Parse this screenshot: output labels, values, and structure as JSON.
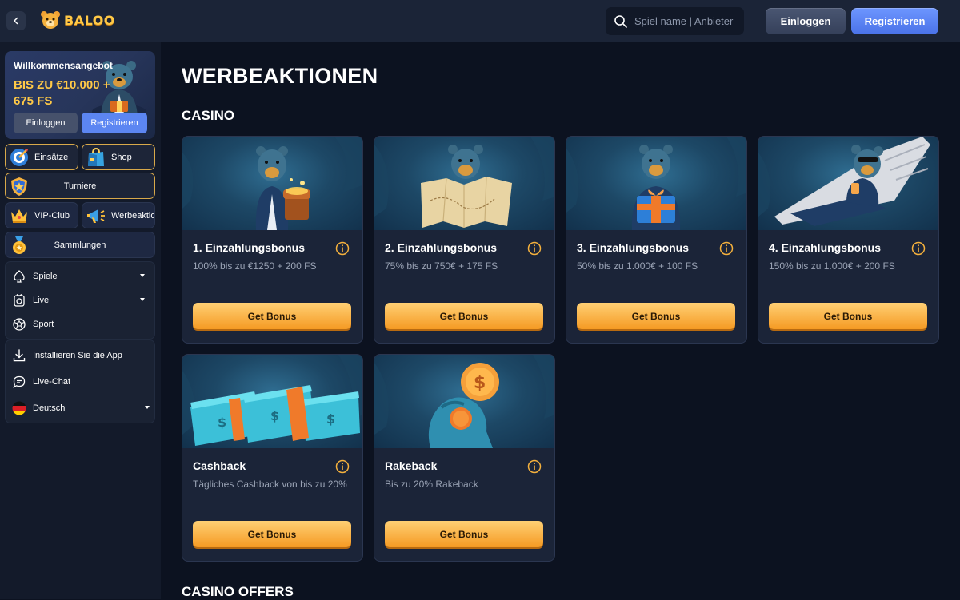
{
  "header": {
    "logo_text": "BALOO",
    "search_placeholder": "Spiel name | Anbieter",
    "login_label": "Einloggen",
    "register_label": "Registrieren"
  },
  "sidebar": {
    "welcome": {
      "title": "Willkommensangebot",
      "amount": "BIS ZU €10.000 + 675 FS",
      "login_label": "Einloggen",
      "register_label": "Registrieren"
    },
    "tiles": {
      "bets": "Einsätze",
      "shop": "Shop",
      "tournaments": "Turniere",
      "vip": "VIP-Club",
      "promotions": "Werbeaktione",
      "collections": "Sammlungen"
    },
    "nav": {
      "games": "Spiele",
      "live": "Live",
      "sport": "Sport"
    },
    "extra": {
      "install": "Installieren Sie die App",
      "chat": "Live-Chat",
      "language": "Deutsch"
    }
  },
  "main": {
    "page_title": "WERBEAKTIONEN",
    "section_casino": "CASINO",
    "section_offers": "CASINO OFFERS",
    "button_label": "Get Bonus",
    "cards": [
      {
        "title": "1. Einzahlungsbonus",
        "desc": "100% bis zu €1250 + 200 FS"
      },
      {
        "title": "2. Einzahlungsbonus",
        "desc": "75% bis zu 750€ + 175 FS"
      },
      {
        "title": "3. Einzahlungsbonus",
        "desc": "50% bis zu 1.000€ + 100 FS"
      },
      {
        "title": "4. Einzahlungsbonus",
        "desc": "150% bis zu 1.000€ + 200 FS"
      },
      {
        "title": "Cashback",
        "desc": "Tägliches Cashback von bis zu 20%"
      },
      {
        "title": "Rakeback",
        "desc": "Bis zu 20% Rakeback"
      }
    ]
  },
  "colors": {
    "accent_gold": "#ffc947",
    "button_orange": "#f59a23",
    "register_blue": "#4a72e8",
    "background": "#0c1220"
  }
}
